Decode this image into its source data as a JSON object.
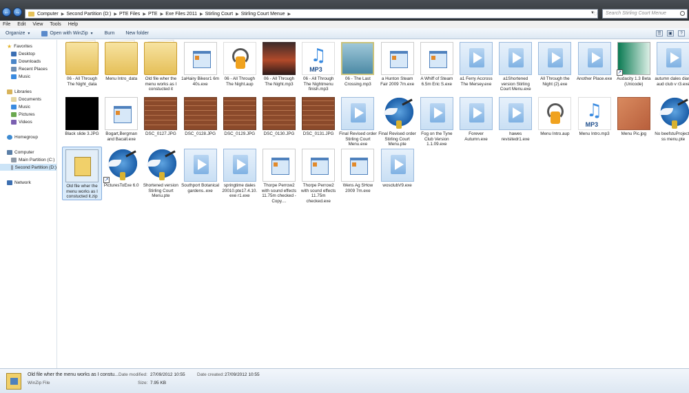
{
  "address": {
    "crumbs": [
      "Computer",
      "Second Partition (D:)",
      "PTE Files",
      "PTE",
      "Exe Files 2011",
      "Stirling Court",
      "Stirling Court Menue"
    ],
    "search_placeholder": "Search Stirling Court Menue"
  },
  "menubar": [
    "File",
    "Edit",
    "View",
    "Tools",
    "Help"
  ],
  "toolbar": {
    "organize": "Organize",
    "open_with": "Open with WinZip",
    "burn": "Burn",
    "new_folder": "New folder"
  },
  "sidebar": {
    "favorites": "Favorites",
    "favorites_items": [
      "Desktop",
      "Downloads",
      "Recent Places",
      "Music"
    ],
    "libraries": "Libraries",
    "libraries_items": [
      "Documents",
      "Music",
      "Pictures",
      "Videos"
    ],
    "homegroup": "Homegroup",
    "computer": "Computer",
    "computer_items": [
      "Main Partition (C:)",
      "Second Partition (D:)"
    ],
    "network": "Network"
  },
  "files": [
    {
      "name": "06 - All Through The Night_data",
      "kind": "folder"
    },
    {
      "name": "Menu Intro_data",
      "kind": "folder"
    },
    {
      "name": "Old file wher the menu works as I constucted it",
      "kind": "folder"
    },
    {
      "name": "1aHairy Bikesr1 6m 40s.exe",
      "kind": "exe"
    },
    {
      "name": "06 - All Through The Night.aup",
      "kind": "audio"
    },
    {
      "name": "06 - All Through The Night.mp3",
      "kind": "sunset"
    },
    {
      "name": "06 - All Through The Nightmenu finish.mp3",
      "kind": "mp3"
    },
    {
      "name": "06 - The Last Crossing.mp3",
      "kind": "celtic"
    },
    {
      "name": "a Hunton Steam Fair 2009 7m.exe",
      "kind": "exe"
    },
    {
      "name": "A Whiff of Steam 6.5m Eric S.exe",
      "kind": "exe"
    },
    {
      "name": "a1 Ferry Accross The Mersey.exe",
      "kind": "video"
    },
    {
      "name": "a1Shortened version Stirling Court Menu.exe",
      "kind": "video"
    },
    {
      "name": "All Through the Night (2).exe",
      "kind": "video"
    },
    {
      "name": "Another Place.exe",
      "kind": "video"
    },
    {
      "name": "Audacity 1.3 Beta (Unicode)",
      "kind": "audacity"
    },
    {
      "name": "autumn dales diary aud club v r3.exe",
      "kind": "video"
    },
    {
      "name": "Black slide 3.JPG",
      "kind": "black"
    },
    {
      "name": "Bogart,Bergman and Bacall.exe",
      "kind": "exe"
    },
    {
      "name": "DSC_0127.JPG",
      "kind": "brick"
    },
    {
      "name": "DSC_0128.JPG",
      "kind": "brick"
    },
    {
      "name": "DSC_0129.JPG",
      "kind": "brick"
    },
    {
      "name": "DSC_0130.JPG",
      "kind": "brick"
    },
    {
      "name": "DSC_0131.JPG",
      "kind": "brick"
    },
    {
      "name": "Final Revised order Stirling Court Menu.exe",
      "kind": "video"
    },
    {
      "name": "Final Revised order Stirling Court Menu.pte",
      "kind": "bird"
    },
    {
      "name": "Fog on the Tyne Club Version 1.1.09.exe",
      "kind": "video"
    },
    {
      "name": "Forever Autumn.exe",
      "kind": "video"
    },
    {
      "name": "hawes revisitedr1.exe",
      "kind": "video"
    },
    {
      "name": "Menu Intro.aup",
      "kind": "audio"
    },
    {
      "name": "Menu Intro.mp3",
      "kind": "mp3"
    },
    {
      "name": "Menu Pic.jpg",
      "kind": "menupic"
    },
    {
      "name": "No beefstuProject1 ss menu.pte",
      "kind": "bird"
    },
    {
      "name": "Old file wher the menu works as I constucted it.zip",
      "kind": "winzip"
    },
    {
      "name": "PicturesToExe 6.0",
      "kind": "bird"
    },
    {
      "name": "Shortened version Stirling Court Menu.pte",
      "kind": "bird"
    },
    {
      "name": "Southport Botanical gardens..exe",
      "kind": "video"
    },
    {
      "name": "springtime dales 20010.pte17.4.10. exe r1.exe",
      "kind": "video"
    },
    {
      "name": "Thorpe Perrow2 with sound effects 11.75m checked - Copy....",
      "kind": "exe"
    },
    {
      "name": "Thorpe Perrow2 with sound effects 11.75m checked.exe",
      "kind": "exe"
    },
    {
      "name": "Wens Ag SHow 2009 7m.exe",
      "kind": "exe"
    },
    {
      "name": "wosclubV9.exe",
      "kind": "video"
    }
  ],
  "details": {
    "name": "Old file wher the menu works as I constu...",
    "type": "WinZip File",
    "modified_label": "Date modified:",
    "modified_value": "27/09/2012 10:55",
    "size_label": "Size:",
    "size_value": "7.95 KB",
    "created_label": "Date created:",
    "created_value": "27/09/2012 10:55"
  }
}
